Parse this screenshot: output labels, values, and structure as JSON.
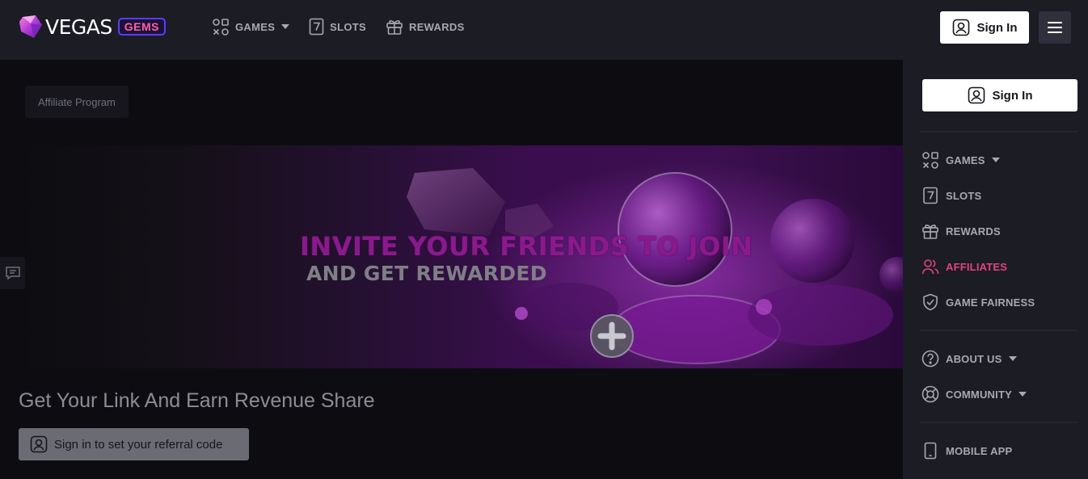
{
  "brand": {
    "name": "VEGAS",
    "badge": "GEMS"
  },
  "topnav": {
    "items": [
      {
        "label": "GAMES",
        "icon": "games-icon",
        "dropdown": true
      },
      {
        "label": "SLOTS",
        "icon": "slot-seven-icon"
      },
      {
        "label": "REWARDS",
        "icon": "gift-icon"
      }
    ],
    "sign_in": "Sign In"
  },
  "main": {
    "breadcrumb": "Affiliate Program",
    "banner": {
      "title": "INVITE YOUR FRIENDS TO JOIN",
      "subtitle": "AND GET REWARDED"
    },
    "section_title": "Get Your Link And Earn Revenue Share",
    "referral_button": "Sign in to set your referral code"
  },
  "sidebar": {
    "sign_in": "Sign In",
    "items": [
      {
        "label": "GAMES",
        "icon": "games-icon",
        "dropdown": true
      },
      {
        "label": "SLOTS",
        "icon": "slot-seven-icon"
      },
      {
        "label": "REWARDS",
        "icon": "gift-icon"
      },
      {
        "label": "AFFILIATES",
        "icon": "users-icon",
        "active": true
      },
      {
        "label": "GAME FAIRNESS",
        "icon": "shield-check-icon"
      },
      {
        "label": "ABOUT US",
        "icon": "question-icon",
        "dropdown": true
      },
      {
        "label": "COMMUNITY",
        "icon": "lifebuoy-icon",
        "dropdown": true
      },
      {
        "label": "MOBILE APP",
        "icon": "mobile-icon"
      }
    ]
  },
  "colors": {
    "accent": "#e0457b",
    "badge_border": "#5b3bff",
    "banner_purple": "#8a1a8c"
  }
}
